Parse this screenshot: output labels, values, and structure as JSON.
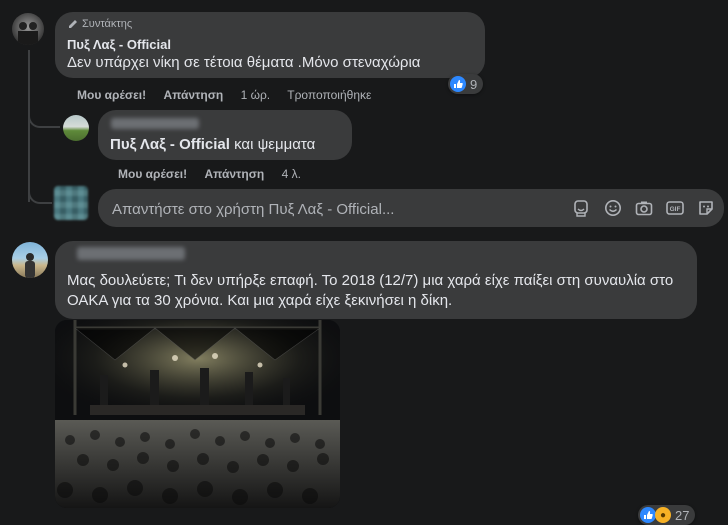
{
  "comment1": {
    "badge_label": "Συντάκτης",
    "author": "Πυξ Λαξ - Official",
    "text": "Δεν υπάρχει νίκη σε τέτοια θέματα .Μόνο στεναχώρια",
    "like_label": "Μου αρέσει!",
    "reply_label": "Απάντηση",
    "time": "1 ώρ.",
    "edited": "Τροποποιήθηκε",
    "reaction_count": "9"
  },
  "reply1": {
    "mention": "Πυξ Λαξ - Official",
    "text": "και ψεμματα",
    "like_label": "Μου αρέσει!",
    "reply_label": "Απάντηση",
    "time": "4 λ."
  },
  "reply_input": {
    "placeholder": "Απαντήστε στο χρήστη Πυξ Λαξ - Official..."
  },
  "comment2": {
    "text": "Μας δουλεύετε; Τι δεν υπήρξε επαφή. Το 2018 (12/7) μια χαρά είχε παίξει στη συναυλία στο ΟΑΚΑ για τα 30 χρόνια. Και μια χαρά είχε ξεκινήσει η δίκη.",
    "reaction_count": "27"
  },
  "colors": {
    "background": "#18191a",
    "bubble": "#3a3b3c",
    "like_blue": "#2d88ff",
    "secondary_text": "#b0b3b8"
  }
}
